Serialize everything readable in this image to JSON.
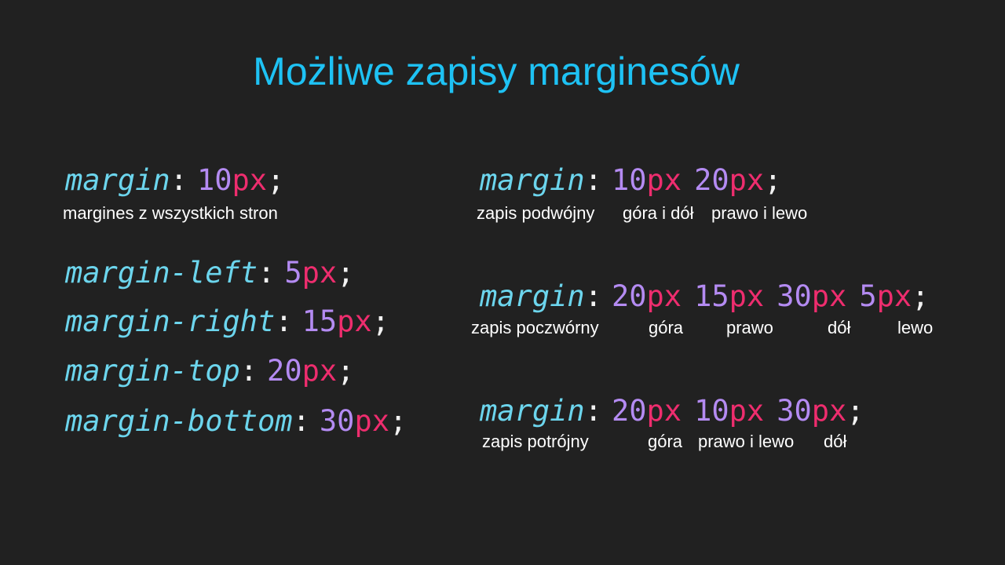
{
  "title": "Możliwe zapisy marginesów",
  "colors": {
    "background": "#212121",
    "title": "#1ec2f4",
    "property": "#6cd5ed",
    "number": "#b48bf2",
    "unit": "#ee2d6e",
    "punctuation": "#f2f2f2"
  },
  "single": {
    "prop": "margin",
    "colon": ":",
    "value": {
      "num": "10",
      "unit": "px"
    },
    "semi": ";",
    "caption": "margines z wszystkich stron"
  },
  "longhand": [
    {
      "prop": "margin-left",
      "colon": ":",
      "num": "5",
      "unit": "px",
      "semi": ";"
    },
    {
      "prop": "margin-right",
      "colon": ":",
      "num": "15",
      "unit": "px",
      "semi": ";"
    },
    {
      "prop": "margin-top",
      "colon": ":",
      "num": "20",
      "unit": "px",
      "semi": ";"
    },
    {
      "prop": "margin-bottom",
      "colon": ":",
      "num": "30",
      "unit": "px",
      "semi": ";"
    }
  ],
  "double": {
    "prop": "margin",
    "colon": ":",
    "values": [
      {
        "num": "10",
        "unit": "px"
      },
      {
        "num": "20",
        "unit": "px"
      }
    ],
    "semi": ";",
    "captions": [
      "zapis podwójny",
      "góra i dół",
      "prawo i lewo"
    ]
  },
  "quadruple": {
    "prop": "margin",
    "colon": ":",
    "values": [
      {
        "num": "20",
        "unit": "px"
      },
      {
        "num": "15",
        "unit": "px"
      },
      {
        "num": "30",
        "unit": "px"
      },
      {
        "num": "5",
        "unit": "px"
      }
    ],
    "semi": ";",
    "captions": [
      "zapis poczwórny",
      "góra",
      "prawo",
      "dół",
      "lewo"
    ]
  },
  "triple": {
    "prop": "margin",
    "colon": ":",
    "values": [
      {
        "num": "20",
        "unit": "px"
      },
      {
        "num": "10",
        "unit": "px"
      },
      {
        "num": "30",
        "unit": "px"
      }
    ],
    "semi": ";",
    "captions": [
      "zapis potrójny",
      "góra",
      "prawo i lewo",
      "dół"
    ]
  }
}
